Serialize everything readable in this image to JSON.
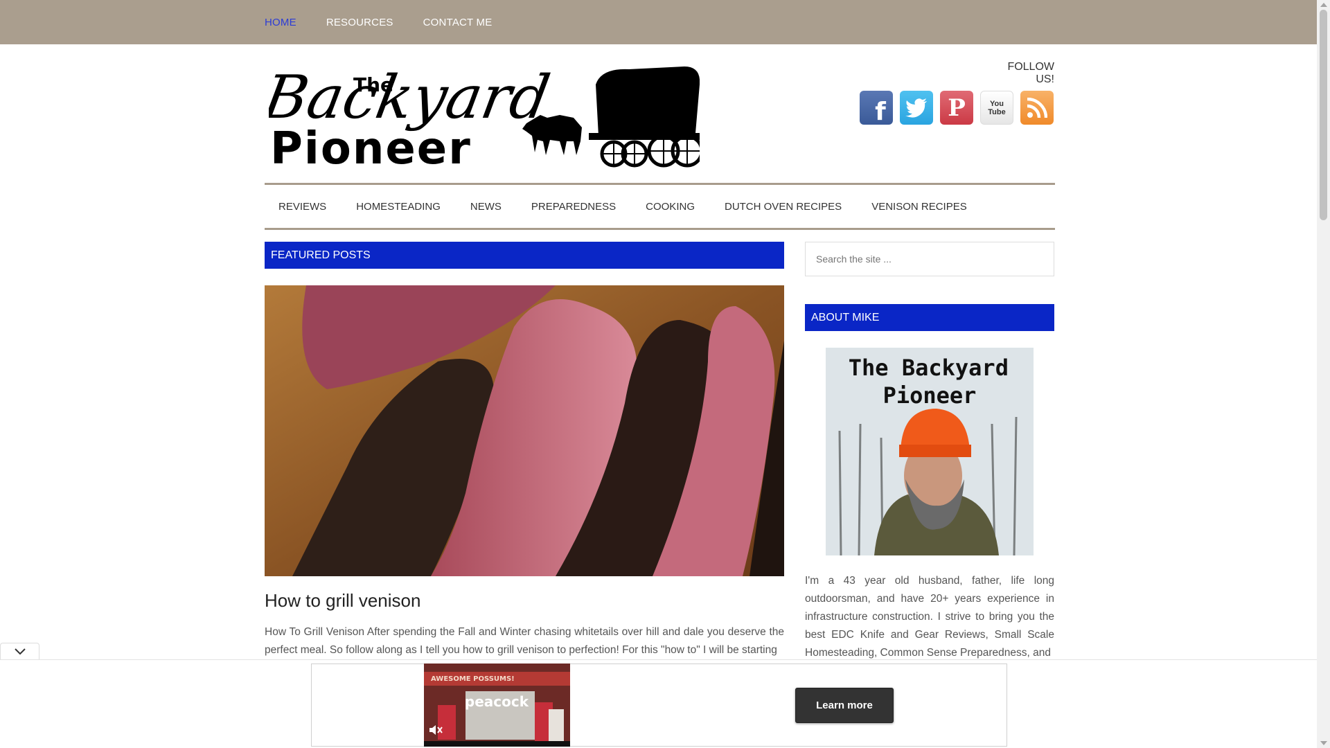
{
  "top_nav": {
    "items": [
      {
        "label": "HOME"
      },
      {
        "label": "RESOURCES"
      },
      {
        "label": "CONTACT ME"
      }
    ]
  },
  "header": {
    "logo_text": "The Backyard Pioneer",
    "follow_label": "FOLLOW US!",
    "social": [
      {
        "name": "facebook-icon",
        "glyph": "f"
      },
      {
        "name": "twitter-icon",
        "glyph": "t"
      },
      {
        "name": "pinterest-icon",
        "glyph": "P"
      },
      {
        "name": "youtube-icon",
        "glyph": "You Tube"
      },
      {
        "name": "rss-icon",
        "glyph": "rss"
      }
    ]
  },
  "main_menu": {
    "items": [
      {
        "label": "REVIEWS"
      },
      {
        "label": "HOMESTEADING"
      },
      {
        "label": "NEWS"
      },
      {
        "label": "PREPAREDNESS"
      },
      {
        "label": "COOKING"
      },
      {
        "label": "DUTCH OVEN RECIPES"
      },
      {
        "label": "VENISON RECIPES"
      }
    ]
  },
  "featured": {
    "heading": "FEATURED POSTS",
    "post_title": "How to grill venison",
    "excerpt": "How To Grill Venison After spending the Fall and Winter chasing whitetails over hill and dale you deserve the perfect meal. So follow along as I tell you how to grill venison to perfection! For this \"how to\" I will be starting"
  },
  "sidebar": {
    "search_placeholder": "Search the site ...",
    "about_heading": "ABOUT MIKE",
    "about_image_title": "The Backyard Pioneer",
    "about_text": "I'm a 43 year old husband, father, life long outdoorsman, and have 20+ years experience in infrastructure construction. I strive to bring you the best EDC Knife and Gear Reviews, Small Scale Homesteading, Common Sense Preparedness, and"
  },
  "ad": {
    "video_banner": "AWESOME POSSUMS!",
    "video_brand": "peacock",
    "cta_label": "Learn more"
  },
  "colors": {
    "topbar": "#aa9e8e",
    "heading_blue": "#0a26c6",
    "active_link": "#2b3bd6"
  }
}
